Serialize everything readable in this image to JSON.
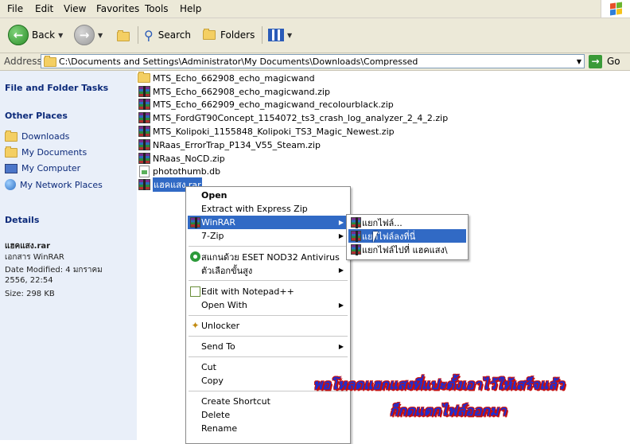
{
  "menubar": {
    "items": [
      "File",
      "Edit",
      "View",
      "Favorites",
      "Tools",
      "Help"
    ]
  },
  "toolbar": {
    "back": "Back",
    "search": "Search",
    "folders": "Folders"
  },
  "address": {
    "label": "Address",
    "path": "C:\\Documents and Settings\\Administrator\\My Documents\\Downloads\\Compressed",
    "go": "Go"
  },
  "leftpane": {
    "file_tasks": "File and Folder Tasks",
    "other_places": "Other Places",
    "places": [
      "Downloads",
      "My Documents",
      "My Computer",
      "My Network Places"
    ],
    "details_title": "Details",
    "details_name": "แฮคแสง.rar",
    "details_type": "เอกสาร WinRAR",
    "details_modified": "Date Modified: 4 มกราคม 2556, 22:54",
    "details_size": "Size: 298 KB"
  },
  "files": [
    {
      "name": "MTS_Echo_662908_echo_magicwand",
      "icon": "folder-icon"
    },
    {
      "name": "MTS_Echo_662908_echo_magicwand.zip",
      "icon": "rar-archive-icon"
    },
    {
      "name": "MTS_Echo_662909_echo_magicwand_recolourblack.zip",
      "icon": "rar-archive-icon"
    },
    {
      "name": "MTS_FordGT90Concept_1154072_ts3_crash_log_analyzer_2_4_2.zip",
      "icon": "rar-archive-icon"
    },
    {
      "name": "MTS_Kolipoki_1155848_Kolipoki_TS3_Magic_Newest.zip",
      "icon": "rar-archive-icon"
    },
    {
      "name": "NRaas_ErrorTrap_P134_V55_Steam.zip",
      "icon": "rar-archive-icon"
    },
    {
      "name": "NRaas_NoCD.zip",
      "icon": "rar-archive-icon"
    },
    {
      "name": "photothumb.db",
      "icon": "db-file-icon"
    },
    {
      "name": "แฮคแสง.rar",
      "icon": "rar-archive-icon",
      "selected": true
    }
  ],
  "context_menu": {
    "open": "Open",
    "extract_express": "Extract with Express Zip",
    "winrar": "WinRAR",
    "sevenzip": "7-Zip",
    "nod32": "สแกนด้วย ESET NOD32 Antivirus",
    "advanced": "ตัวเลือกขั้นสูง",
    "notepad": "Edit with Notepad++",
    "open_with": "Open With",
    "unlocker": "Unlocker",
    "send_to": "Send To",
    "cut": "Cut",
    "copy": "Copy",
    "create_shortcut": "Create Shortcut",
    "delete": "Delete",
    "rename": "Rename"
  },
  "winrar_submenu": {
    "extract_files": "แยกไฟล์...",
    "extract_here": "แยกไฟล์ลงที่นี่",
    "extract_to": "แยกไฟล์ไปที่ แฮคแสง\\"
  },
  "caption": {
    "line1": "พอโหลดแฮกแสงที่แปะตั้งเอาไว้ให้เสร็จแล้ว",
    "line2": "ก็กดแตกไฟล์ออกมา"
  }
}
